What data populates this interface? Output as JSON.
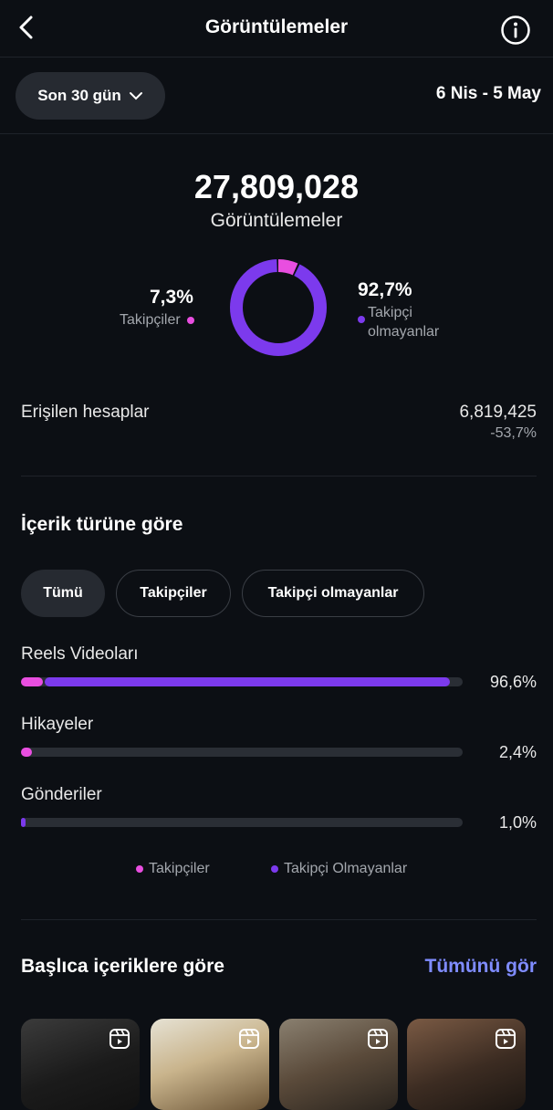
{
  "header": {
    "title": "Görüntülemeler"
  },
  "range": {
    "label": "Son 30 gün",
    "dates": "6 Nis - 5 May"
  },
  "summary": {
    "total": "27,809,028",
    "label": "Görüntülemeler"
  },
  "breakdown": {
    "followers": {
      "pct": "7,3%",
      "label": "Takipçiler",
      "fraction": 0.073,
      "color": "#e94ee0"
    },
    "non_followers": {
      "pct": "92,7%",
      "label_line1": "Takipçi",
      "label_line2": "olmayanlar",
      "fraction": 0.927,
      "color": "#7c3aed"
    }
  },
  "reached": {
    "label": "Erişilen hesaplar",
    "value": "6,819,425",
    "change": "-53,7%"
  },
  "content_type": {
    "title": "İçerik türüne göre",
    "filters": [
      "Tümü",
      "Takipçiler",
      "Takipçi olmayanlar"
    ],
    "rows": [
      {
        "label": "Reels Videoları",
        "pct": "96,6%",
        "followers": 0.05,
        "non_followers": 0.916
      },
      {
        "label": "Hikayeler",
        "pct": "2,4%",
        "followers": 0.024,
        "non_followers": 0.0
      },
      {
        "label": "Gönderiler",
        "pct": "1,0%",
        "followers": 0.0,
        "non_followers": 0.01
      }
    ],
    "legend": {
      "followers": "Takipçiler",
      "non_followers": "Takipçi Olmayanlar"
    }
  },
  "top_content": {
    "title": "Başlıca içeriklere göre",
    "see_all": "Tümünü gör"
  },
  "icons": [
    "back-icon",
    "info-icon",
    "chevron-down-icon",
    "reels-icon"
  ]
}
